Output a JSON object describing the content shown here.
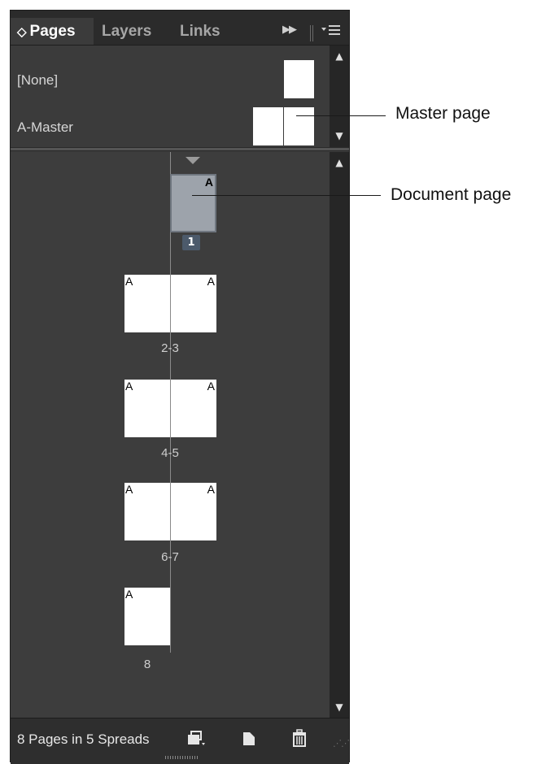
{
  "tabs": [
    {
      "label": "Pages",
      "active": true
    },
    {
      "label": "Layers",
      "active": false
    },
    {
      "label": "Links",
      "active": false
    }
  ],
  "tab_caret": "◇",
  "masters": [
    {
      "label": "[None]"
    },
    {
      "label": "A-Master"
    }
  ],
  "page_prefix": "A",
  "spreads": [
    {
      "label": "1",
      "selected": true
    },
    {
      "label": "2-3"
    },
    {
      "label": "4-5"
    },
    {
      "label": "6-7"
    },
    {
      "label": "8"
    }
  ],
  "footer": {
    "status": "8 Pages in 5 Spreads"
  },
  "callouts": {
    "master": "Master page",
    "document": "Document page"
  },
  "colors": {
    "panel_bg": "#3b3b3b",
    "selected_page": "#9da3ab",
    "page_number_badge": "#4c5a6b"
  }
}
